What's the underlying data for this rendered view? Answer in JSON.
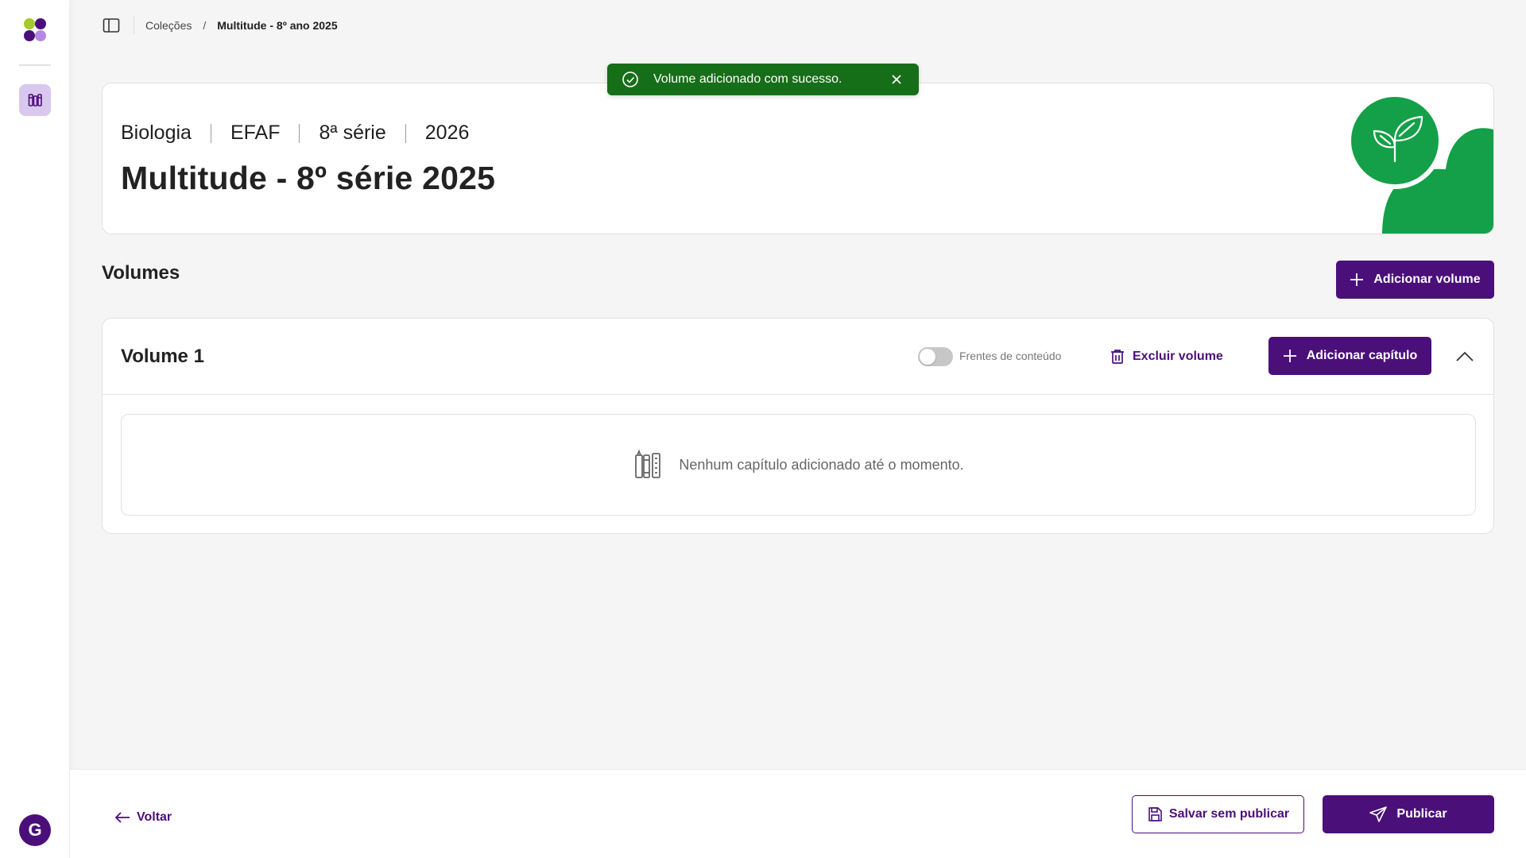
{
  "breadcrumb": {
    "parent": "Coleções",
    "separator": "/",
    "current": "Multitude - 8º ano 2025"
  },
  "toast": {
    "message": "Volume adicionado com sucesso."
  },
  "header": {
    "meta": [
      "Biologia",
      "EFAF",
      "8ª série",
      "2026"
    ],
    "title": "Multitude - 8º série 2025"
  },
  "volumes": {
    "section_title": "Volumes",
    "add_volume_label": "Adicionar volume",
    "items": [
      {
        "title": "Volume 1",
        "toggle_label": "Frentes de conteúdo",
        "toggle_on": false,
        "delete_label": "Excluir volume",
        "add_chapter_label": "Adicionar capítulo",
        "empty_message": "Nenhum capítulo adicionado até o momento."
      }
    ]
  },
  "footer": {
    "back_label": "Voltar",
    "save_label": "Salvar sem publicar",
    "publish_label": "Publicar"
  },
  "user": {
    "avatar_initial": "G"
  },
  "colors": {
    "primary": "#4b0f7a",
    "success": "#176e18",
    "accent_green": "#13a049",
    "active_item_bg": "#d9c8ee"
  },
  "icons": {
    "logo": "app-logo-icon",
    "sidebar": "books-icon",
    "panel": "sidebar-panel-icon",
    "toast": "check-circle-icon",
    "close": "close-icon",
    "add": "plus-icon",
    "delete": "trash-icon",
    "collapse": "chevron-up-icon",
    "empty": "books-icon",
    "back": "arrow-left-icon",
    "save": "floppy-disk-icon",
    "publish": "send-icon",
    "header_deco": "leaf-icon"
  }
}
